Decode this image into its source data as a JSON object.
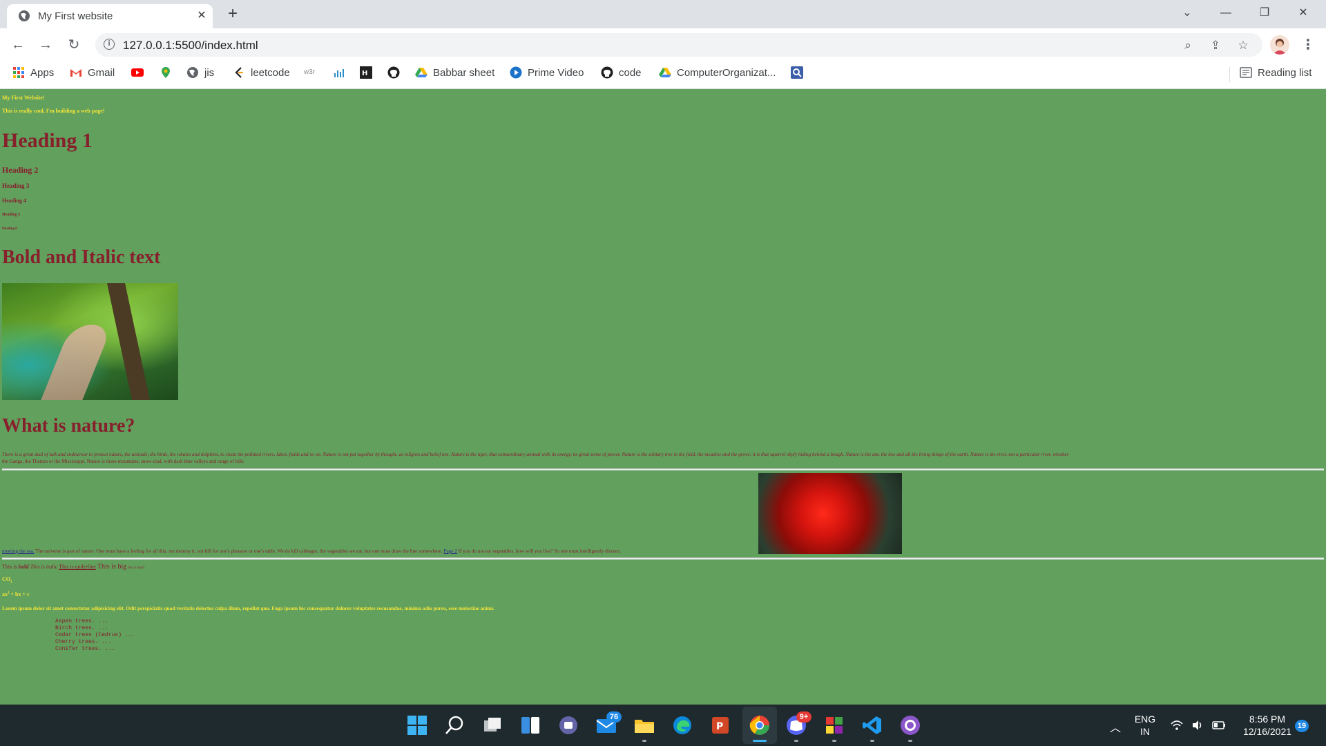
{
  "browser": {
    "tab_title": "My First website",
    "url": "127.0.0.1:5500/index.html",
    "bookmarks": [
      {
        "label": "Apps",
        "icon": "apps-grid-icon"
      },
      {
        "label": "Gmail",
        "icon": "gmail-icon"
      },
      {
        "label": "",
        "icon": "youtube-icon"
      },
      {
        "label": "",
        "icon": "maps-icon"
      },
      {
        "label": "jis",
        "icon": "globe-icon"
      },
      {
        "label": "leetcode",
        "icon": "leetcode-icon"
      },
      {
        "label": "",
        "icon": "w3-icon"
      },
      {
        "label": "",
        "icon": "chart-icon"
      },
      {
        "label": "",
        "icon": "hackerrank-icon"
      },
      {
        "label": "",
        "icon": "github-icon"
      },
      {
        "label": "Babbar sheet",
        "icon": "drive-icon"
      },
      {
        "label": "Prime Video",
        "icon": "prime-video-icon"
      },
      {
        "label": "code",
        "icon": "github-icon"
      },
      {
        "label": "ComputerOrganizat...",
        "icon": "drive-icon"
      },
      {
        "label": "",
        "icon": "search-box-icon"
      }
    ],
    "reading_list": "Reading list"
  },
  "page": {
    "top_line_1": "My First Website!",
    "top_line_2": "This is really cool, I'm building a web page!",
    "h1": "Heading 1",
    "h2": "Heading 2",
    "h3": "Heading 3",
    "h4": "Heading 4",
    "h5": "Heading 5",
    "h6": "Heading 6",
    "bold_italic_heading": "Bold and Italic text",
    "nature_heading": "What is nature?",
    "nature_para_1": "There is a great deal of talk and endeavour to protect nature, the animals, the birds, the whales and dolphins, to clean the polluted rivers, lakes, fields and so on. Nature is not put together by thought, as religion and belief are. Nature is the tiger, that extraordinary animal with its energy, its great sense of power. Nature is the solitary tree in the field, the meadow and the grove; it is that squirrel shyly hiding behind a bough. Nature is the ant, the bee and all the living things of the earth. Nature is the river, not a particular river, whether",
    "nature_para_2": "the Ganga, the Thames or the Mississippi. Nature is those mountains, snow-clad, with dark blue valleys and range of hills",
    "link_meeting": "meeting the sea.",
    "para_universe": "The universe is part of nature. One must have a feeling for all this, not destroy it, not kill for one's pleasure or one's table. We do kill cabbages, the vegetables we eat, but one must draw the line somewhere.",
    "link_page2": "Page 2",
    "para_vegetables": "If you do not eat vegetables, how will you live? So one must intelligently discern.",
    "fmt_this_is": "This is",
    "fmt_bold": "bold",
    "fmt_italic": "This is italic",
    "fmt_underline": "This is underline",
    "fmt_big": "This is big",
    "fmt_small": "this is small",
    "co2": "CO",
    "co2_sub": "2",
    "eq_a": "ax",
    "eq_sup": "2",
    "eq_b": "+ bx + c",
    "lorem": "Lorem ipsum dolor sit amet consectetur adipisicing elit. Odit perspiciatis quod veritatis delectus culpa illum, repellat quo. Fuga ipsum hic consequatur dolores voluptates recusandae, minima odio porro, esse molestiae animi.",
    "pre_lines": "Aspen trees. ...\nBirch trees. ...\nCedar trees (Cedrus) ...\nCherry trees. ...\nConifer trees. ..."
  },
  "taskbar": {
    "lang_1": "ENG",
    "lang_2": "IN",
    "time": "8:56 PM",
    "date": "12/16/2021",
    "mail_badge": "76",
    "discord_badge": "9+",
    "notif_badge": "19"
  },
  "colors": {
    "page_bg": "#62a05e",
    "heading": "#86202c",
    "top_text": "#f4e537"
  }
}
